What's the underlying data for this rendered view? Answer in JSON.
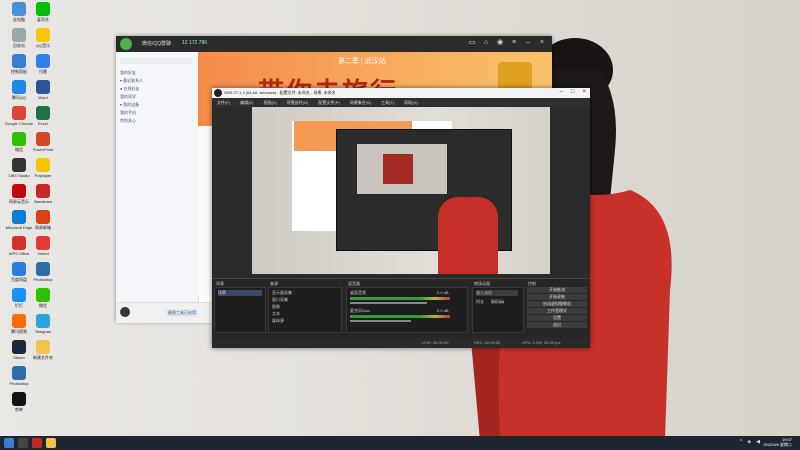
{
  "desktop": {
    "icons": [
      {
        "label": "此电脑",
        "color": "#4a90d9"
      },
      {
        "label": "回收站",
        "color": "#9aa"
      },
      {
        "label": "控制面板",
        "color": "#3a7bd5"
      },
      {
        "label": "腾讯QQ",
        "color": "#1e88e5"
      },
      {
        "label": "Google Chrome",
        "color": "#db4437"
      },
      {
        "label": "微信",
        "color": "#2dc100"
      },
      {
        "label": "OBS Studio",
        "color": "#333"
      },
      {
        "label": "网易云音乐",
        "color": "#c20c0c"
      },
      {
        "label": "Microsoft Edge",
        "color": "#0a7cd1"
      },
      {
        "label": "WPS Office",
        "color": "#d32f2f"
      },
      {
        "label": "百度网盘",
        "color": "#2a7de1"
      },
      {
        "label": "钉钉",
        "color": "#1890ff"
      },
      {
        "label": "腾讯视频",
        "color": "#ff6a00"
      },
      {
        "label": "Steam",
        "color": "#1b2838"
      },
      {
        "label": "Photoshop",
        "color": "#2d6ea8"
      },
      {
        "label": "剪映",
        "color": "#111"
      },
      {
        "label": "爱奇艺",
        "color": "#00be06"
      },
      {
        "label": "QQ音乐",
        "color": "#f9c600"
      },
      {
        "label": "迅雷",
        "color": "#2f80ed"
      },
      {
        "label": "Word",
        "color": "#2b579a"
      },
      {
        "label": "Excel",
        "color": "#217346"
      },
      {
        "label": "PowerPoint",
        "color": "#d24726"
      },
      {
        "label": "Potplayer",
        "color": "#f5c400"
      },
      {
        "label": "Bandicam",
        "color": "#c62828"
      },
      {
        "label": "网易邮箱",
        "color": "#d84315"
      },
      {
        "label": "Xmind",
        "color": "#e53935"
      },
      {
        "label": "Photoshop",
        "color": "#2d6ea8"
      },
      {
        "label": "微信",
        "color": "#2dc100"
      },
      {
        "label": "Telegram",
        "color": "#2aa3e0"
      },
      {
        "label": "新建文件夹",
        "color": "#f2c14e"
      }
    ]
  },
  "qq": {
    "title": "微信/QQ群聊",
    "number": "12 172 786",
    "banner_sub": "第二季 | 武汉站",
    "banner_main": "带你去旅行",
    "sidebar_rows": [
      "我的好友",
      "▾ 最近联系人",
      "  ● 在线好友",
      "我的同学",
      "▾ 我的设备",
      "  我的手机",
      "特别关心"
    ],
    "bottom_tip": "截图工具已启用"
  },
  "obs": {
    "title": "OBS 27.1.3 (64-bit, windows) - 配置文件: 未命名 - 场景: 未命名",
    "menu": [
      "文件(F)",
      "编辑(E)",
      "视图(V)",
      "停靠部件(D)",
      "配置文件(P)",
      "场景集合(S)",
      "工具(T)",
      "帮助(H)"
    ],
    "scenes_title": "场景",
    "sources_title": "来源",
    "mixer_title": "混音器",
    "transitions_title": "转场动画",
    "controls_title": "控制",
    "scene_item": "场景",
    "sources": [
      "显示器采集",
      "窗口采集",
      "图像",
      "文本",
      "媒体源"
    ],
    "mixer": [
      {
        "name": "桌面音频",
        "db": "0.0 dB",
        "level": 0.7
      },
      {
        "name": "麦克风/Aux",
        "db": "0.0 dB",
        "level": 0.55
      }
    ],
    "transition": "淡入淡出",
    "duration_label": "时长",
    "duration": "300 ms",
    "controls": [
      "开始推流",
      "开始录制",
      "启动虚拟摄像机",
      "工作室模式",
      "设置",
      "退出"
    ],
    "status": {
      "live": "LIVE: 00:00:00",
      "rec": "REC: 00:00:00",
      "cpu": "CPU: 2.3%, 30.00 fps"
    }
  },
  "taskbar": {
    "time": "19:07",
    "date": "2022/9/6 星期二"
  }
}
